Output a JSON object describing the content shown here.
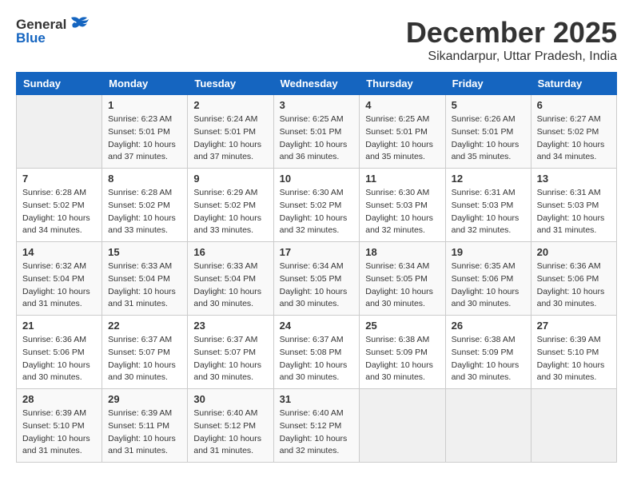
{
  "logo": {
    "general": "General",
    "blue": "Blue"
  },
  "title": {
    "month": "December 2025",
    "location": "Sikandarpur, Uttar Pradesh, India"
  },
  "headers": [
    "Sunday",
    "Monday",
    "Tuesday",
    "Wednesday",
    "Thursday",
    "Friday",
    "Saturday"
  ],
  "weeks": [
    [
      {
        "day": "",
        "info": ""
      },
      {
        "day": "1",
        "info": "Sunrise: 6:23 AM\nSunset: 5:01 PM\nDaylight: 10 hours\nand 37 minutes."
      },
      {
        "day": "2",
        "info": "Sunrise: 6:24 AM\nSunset: 5:01 PM\nDaylight: 10 hours\nand 37 minutes."
      },
      {
        "day": "3",
        "info": "Sunrise: 6:25 AM\nSunset: 5:01 PM\nDaylight: 10 hours\nand 36 minutes."
      },
      {
        "day": "4",
        "info": "Sunrise: 6:25 AM\nSunset: 5:01 PM\nDaylight: 10 hours\nand 35 minutes."
      },
      {
        "day": "5",
        "info": "Sunrise: 6:26 AM\nSunset: 5:01 PM\nDaylight: 10 hours\nand 35 minutes."
      },
      {
        "day": "6",
        "info": "Sunrise: 6:27 AM\nSunset: 5:02 PM\nDaylight: 10 hours\nand 34 minutes."
      }
    ],
    [
      {
        "day": "7",
        "info": "Sunrise: 6:28 AM\nSunset: 5:02 PM\nDaylight: 10 hours\nand 34 minutes."
      },
      {
        "day": "8",
        "info": "Sunrise: 6:28 AM\nSunset: 5:02 PM\nDaylight: 10 hours\nand 33 minutes."
      },
      {
        "day": "9",
        "info": "Sunrise: 6:29 AM\nSunset: 5:02 PM\nDaylight: 10 hours\nand 33 minutes."
      },
      {
        "day": "10",
        "info": "Sunrise: 6:30 AM\nSunset: 5:02 PM\nDaylight: 10 hours\nand 32 minutes."
      },
      {
        "day": "11",
        "info": "Sunrise: 6:30 AM\nSunset: 5:03 PM\nDaylight: 10 hours\nand 32 minutes."
      },
      {
        "day": "12",
        "info": "Sunrise: 6:31 AM\nSunset: 5:03 PM\nDaylight: 10 hours\nand 32 minutes."
      },
      {
        "day": "13",
        "info": "Sunrise: 6:31 AM\nSunset: 5:03 PM\nDaylight: 10 hours\nand 31 minutes."
      }
    ],
    [
      {
        "day": "14",
        "info": "Sunrise: 6:32 AM\nSunset: 5:04 PM\nDaylight: 10 hours\nand 31 minutes."
      },
      {
        "day": "15",
        "info": "Sunrise: 6:33 AM\nSunset: 5:04 PM\nDaylight: 10 hours\nand 31 minutes."
      },
      {
        "day": "16",
        "info": "Sunrise: 6:33 AM\nSunset: 5:04 PM\nDaylight: 10 hours\nand 30 minutes."
      },
      {
        "day": "17",
        "info": "Sunrise: 6:34 AM\nSunset: 5:05 PM\nDaylight: 10 hours\nand 30 minutes."
      },
      {
        "day": "18",
        "info": "Sunrise: 6:34 AM\nSunset: 5:05 PM\nDaylight: 10 hours\nand 30 minutes."
      },
      {
        "day": "19",
        "info": "Sunrise: 6:35 AM\nSunset: 5:06 PM\nDaylight: 10 hours\nand 30 minutes."
      },
      {
        "day": "20",
        "info": "Sunrise: 6:36 AM\nSunset: 5:06 PM\nDaylight: 10 hours\nand 30 minutes."
      }
    ],
    [
      {
        "day": "21",
        "info": "Sunrise: 6:36 AM\nSunset: 5:06 PM\nDaylight: 10 hours\nand 30 minutes."
      },
      {
        "day": "22",
        "info": "Sunrise: 6:37 AM\nSunset: 5:07 PM\nDaylight: 10 hours\nand 30 minutes."
      },
      {
        "day": "23",
        "info": "Sunrise: 6:37 AM\nSunset: 5:07 PM\nDaylight: 10 hours\nand 30 minutes."
      },
      {
        "day": "24",
        "info": "Sunrise: 6:37 AM\nSunset: 5:08 PM\nDaylight: 10 hours\nand 30 minutes."
      },
      {
        "day": "25",
        "info": "Sunrise: 6:38 AM\nSunset: 5:09 PM\nDaylight: 10 hours\nand 30 minutes."
      },
      {
        "day": "26",
        "info": "Sunrise: 6:38 AM\nSunset: 5:09 PM\nDaylight: 10 hours\nand 30 minutes."
      },
      {
        "day": "27",
        "info": "Sunrise: 6:39 AM\nSunset: 5:10 PM\nDaylight: 10 hours\nand 30 minutes."
      }
    ],
    [
      {
        "day": "28",
        "info": "Sunrise: 6:39 AM\nSunset: 5:10 PM\nDaylight: 10 hours\nand 31 minutes."
      },
      {
        "day": "29",
        "info": "Sunrise: 6:39 AM\nSunset: 5:11 PM\nDaylight: 10 hours\nand 31 minutes."
      },
      {
        "day": "30",
        "info": "Sunrise: 6:40 AM\nSunset: 5:12 PM\nDaylight: 10 hours\nand 31 minutes."
      },
      {
        "day": "31",
        "info": "Sunrise: 6:40 AM\nSunset: 5:12 PM\nDaylight: 10 hours\nand 32 minutes."
      },
      {
        "day": "",
        "info": ""
      },
      {
        "day": "",
        "info": ""
      },
      {
        "day": "",
        "info": ""
      }
    ]
  ]
}
